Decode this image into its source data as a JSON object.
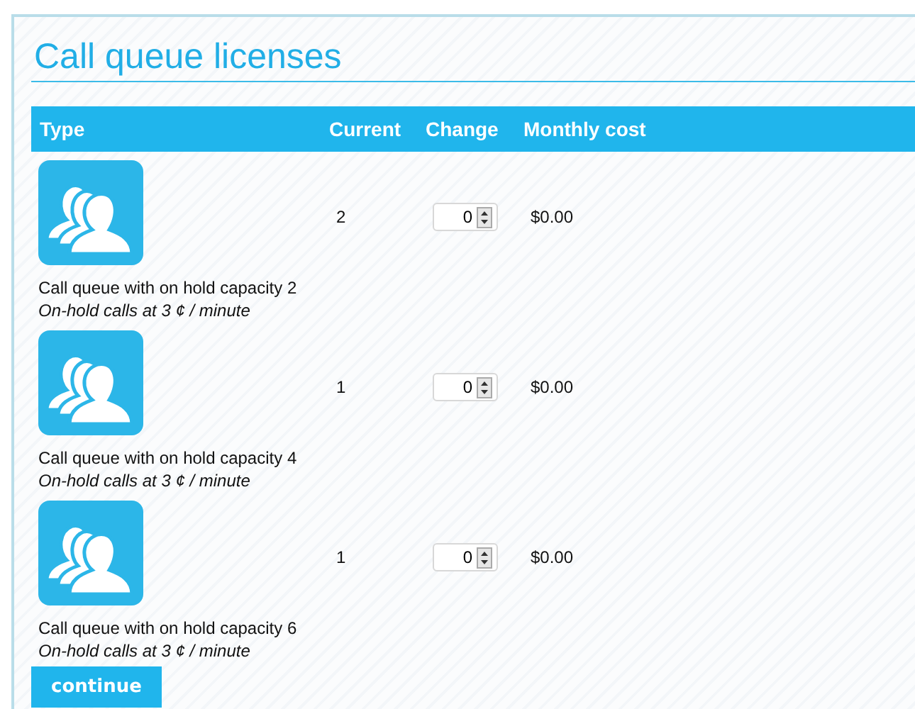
{
  "title": "Call queue licenses",
  "columns": [
    "Type",
    "Current",
    "Change",
    "Monthly cost"
  ],
  "rows": [
    {
      "name": "Call queue with on hold capacity 2",
      "note": "On-hold calls at 3 ¢ / minute",
      "current": "2",
      "change": "0",
      "cost": "$0.00"
    },
    {
      "name": "Call queue with on hold capacity 4",
      "note": "On-hold calls at 3 ¢ / minute",
      "current": "1",
      "change": "0",
      "cost": "$0.00"
    },
    {
      "name": "Call queue with on hold capacity 6",
      "note": "On-hold calls at 3 ¢ / minute",
      "current": "1",
      "change": "0",
      "cost": "$0.00"
    }
  ],
  "button": "continue"
}
